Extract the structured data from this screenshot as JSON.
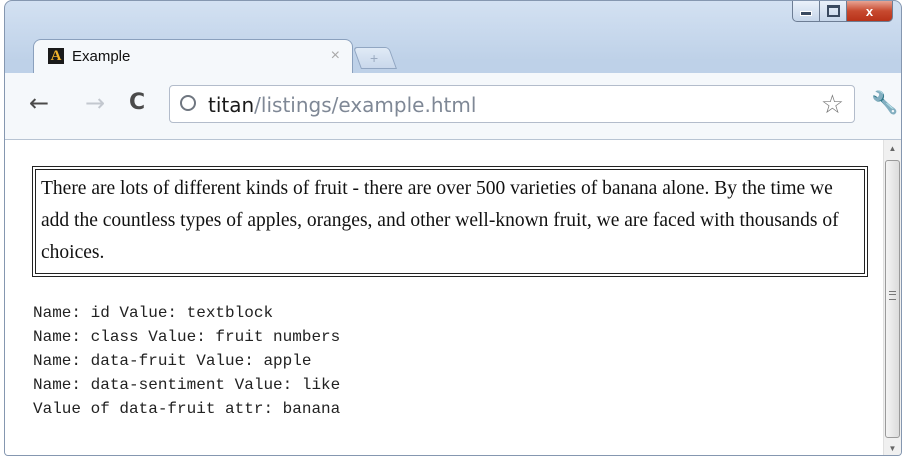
{
  "window": {
    "controls": {
      "close_label": "x"
    }
  },
  "tab": {
    "favicon_letter": "A",
    "title": "Example",
    "close_label": "×",
    "newtab_label": "+"
  },
  "toolbar": {
    "back_label": "←",
    "forward_label": "→",
    "reload_label": "C",
    "url_host": "titan",
    "url_path": "/listings/example.html",
    "star_label": "☆",
    "wrench_label": "🔧"
  },
  "content": {
    "paragraph": "There are lots of different kinds of fruit - there are over 500 varieties of banana alone. By the time we add the countless types of apples, oranges, and other well-known fruit, we are faced with thousands of choices.",
    "output_lines": [
      "Name: id Value: textblock",
      "Name: class Value: fruit numbers",
      "Name: data-fruit Value: apple",
      "Name: data-sentiment Value: like",
      "Value of data-fruit attr: banana"
    ]
  },
  "colors": {
    "accent": "#c74a2f",
    "frame": "#bed1e8"
  }
}
